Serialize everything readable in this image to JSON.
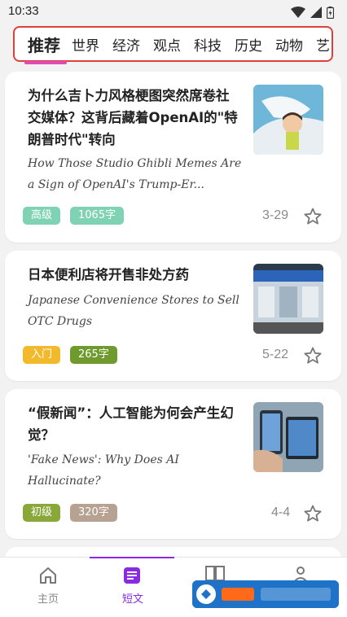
{
  "status": {
    "time": "10:33"
  },
  "tabs": [
    "推荐",
    "世界",
    "经济",
    "观点",
    "科技",
    "历史",
    "动物",
    "艺"
  ],
  "articles": [
    {
      "title": "为什么吉卜力风格梗图突然席卷社交媒体？这背后藏着OpenAI的\"特朗普时代\"转向",
      "subtitle": "How Those Studio Ghibli Memes Are a Sign of OpenAI's Trump-Er...",
      "level": "高级",
      "level_color": "#7fd3b4",
      "words": "1065字",
      "words_color": "#7fd3b4",
      "date": "3-29"
    },
    {
      "title": "日本便利店将开售非处方药",
      "subtitle": "Japanese Convenience Stores to Sell OTC Drugs",
      "level": "入门",
      "level_color": "#f2b92d",
      "words": "265字",
      "words_color": "#6f9b2e",
      "date": "5-22"
    },
    {
      "title": "“假新闻”：人工智能为何会产生幻觉？",
      "subtitle": "'Fake News': Why Does AI Hallucinate?",
      "level": "初级",
      "level_color": "#8aa83a",
      "words": "320字",
      "words_color": "#b7a291",
      "date": "4-4"
    }
  ],
  "nav": {
    "home": "主页",
    "short": "短文",
    "third": "",
    "fourth": ""
  },
  "colors": {
    "accent": "#8a2be2",
    "tab_highlight": "#e0403a"
  }
}
